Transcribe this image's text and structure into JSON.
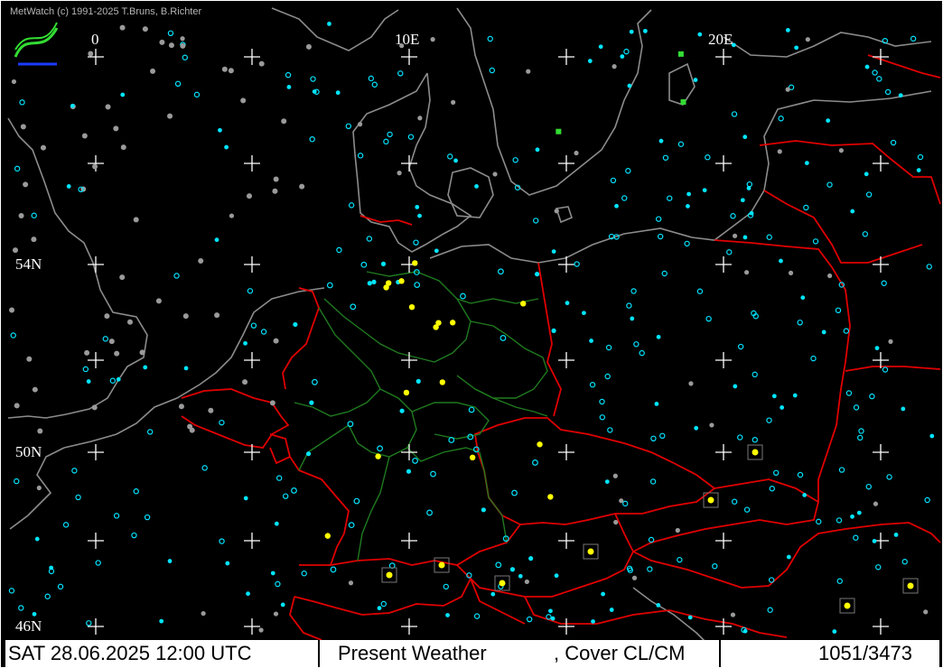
{
  "header": {
    "copyright": "MetWatch  (c) 1991-2025 T.Bruns, B.Richter"
  },
  "grid_labels": {
    "lon_0": "0",
    "lon_10e": "10E",
    "lon_20e": "20E",
    "lat_54n": "54N",
    "lat_50n": "50N",
    "lat_46n": "46N"
  },
  "status_bar": {
    "datetime": "SAT 28.06.2025 12:00 UTC",
    "parameter": "Present Weather",
    "cover": ", Cover CL/CM",
    "count": "1051/3473"
  },
  "map": {
    "colors": {
      "coastline": "#8c8c8c",
      "country_border": "#e00000",
      "state_border": "#1f7a1f",
      "station_gray": "#9a9a9a",
      "station_cyan": "#00e5ff",
      "weather_yellow": "#ffff00",
      "weather_green": "#33dd33",
      "graticule": "#ffffff"
    },
    "symbols": [
      "station-dot",
      "cloud-cover-circle",
      "thunder-symbol",
      "fog-symbol",
      "shower-symbol"
    ]
  }
}
